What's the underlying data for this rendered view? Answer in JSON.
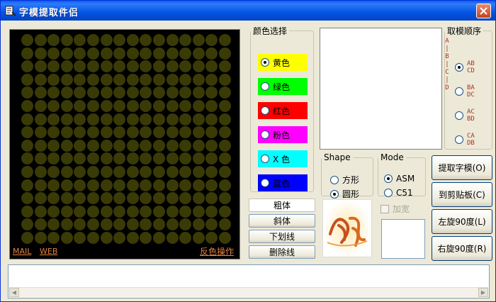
{
  "window": {
    "title": "字模提取件侣"
  },
  "grid": {
    "links": {
      "mail": "MAIL",
      "web": "WEB",
      "invert": "反色操作"
    }
  },
  "colors": {
    "legend": "颜色选择",
    "options": [
      {
        "label": "黄色",
        "bg": "#ffff00",
        "selected": true
      },
      {
        "label": "绿色",
        "bg": "#00ff00",
        "selected": false
      },
      {
        "label": "红色",
        "bg": "#ff0000",
        "selected": false
      },
      {
        "label": "粉色",
        "bg": "#ff00ff",
        "selected": false
      },
      {
        "label": "X 色",
        "bg": "#00ffff",
        "selected": false
      },
      {
        "label": "蓝色",
        "bg": "#0000ff",
        "selected": false
      }
    ]
  },
  "order_letters": [
    "A",
    "|",
    "B",
    "|",
    "C",
    "|",
    "D"
  ],
  "order": {
    "legend": "取模顺序",
    "options": [
      {
        "line1": "AB",
        "line2": "CD",
        "selected": true
      },
      {
        "line1": "BA",
        "line2": "DC",
        "selected": false
      },
      {
        "line1": "AC",
        "line2": "BD",
        "selected": false
      },
      {
        "line1": "CA",
        "line2": "DB",
        "selected": false
      }
    ]
  },
  "shape": {
    "legend": "Shape",
    "options": [
      {
        "label": "方形",
        "selected": false
      },
      {
        "label": "圆形",
        "selected": true
      }
    ]
  },
  "mode": {
    "legend": "Mode",
    "options": [
      {
        "label": "ASM",
        "selected": true
      },
      {
        "label": "C51",
        "selected": false
      }
    ]
  },
  "style_buttons": {
    "bold": "粗体",
    "italic": "斜体",
    "underline": "下划线",
    "strike": "删除线"
  },
  "widen": {
    "label": "加宽",
    "checked": false
  },
  "actions": {
    "extract": "提取字模(O)",
    "clipboard": "到剪贴板(C)",
    "rotate_left": "左旋90度(L)",
    "rotate_right": "右旋90度(R)"
  },
  "logo_text": "九九"
}
